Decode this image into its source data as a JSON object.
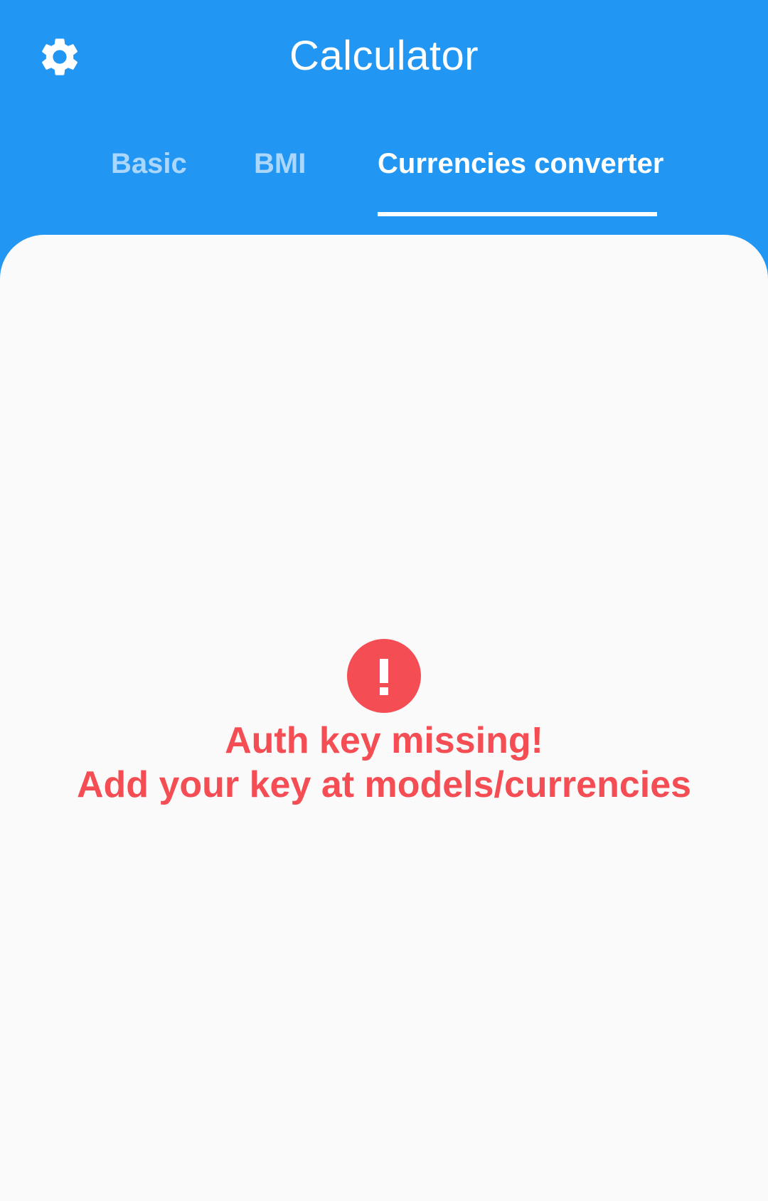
{
  "app": {
    "title": "Calculator"
  },
  "header": {
    "settings_icon": "gear-icon"
  },
  "tabs": [
    {
      "label": "Basic",
      "active": false
    },
    {
      "label": "BMI",
      "active": false
    },
    {
      "label": "Currencies converter",
      "active": true
    }
  ],
  "error": {
    "icon": "error-icon",
    "line1": "Auth key missing!",
    "line2": "Add your key at models/currencies"
  },
  "colors": {
    "primary": "#2196F3",
    "background": "#FAFAFA",
    "error": "#F44E54",
    "on_primary": "#FFFFFF"
  }
}
